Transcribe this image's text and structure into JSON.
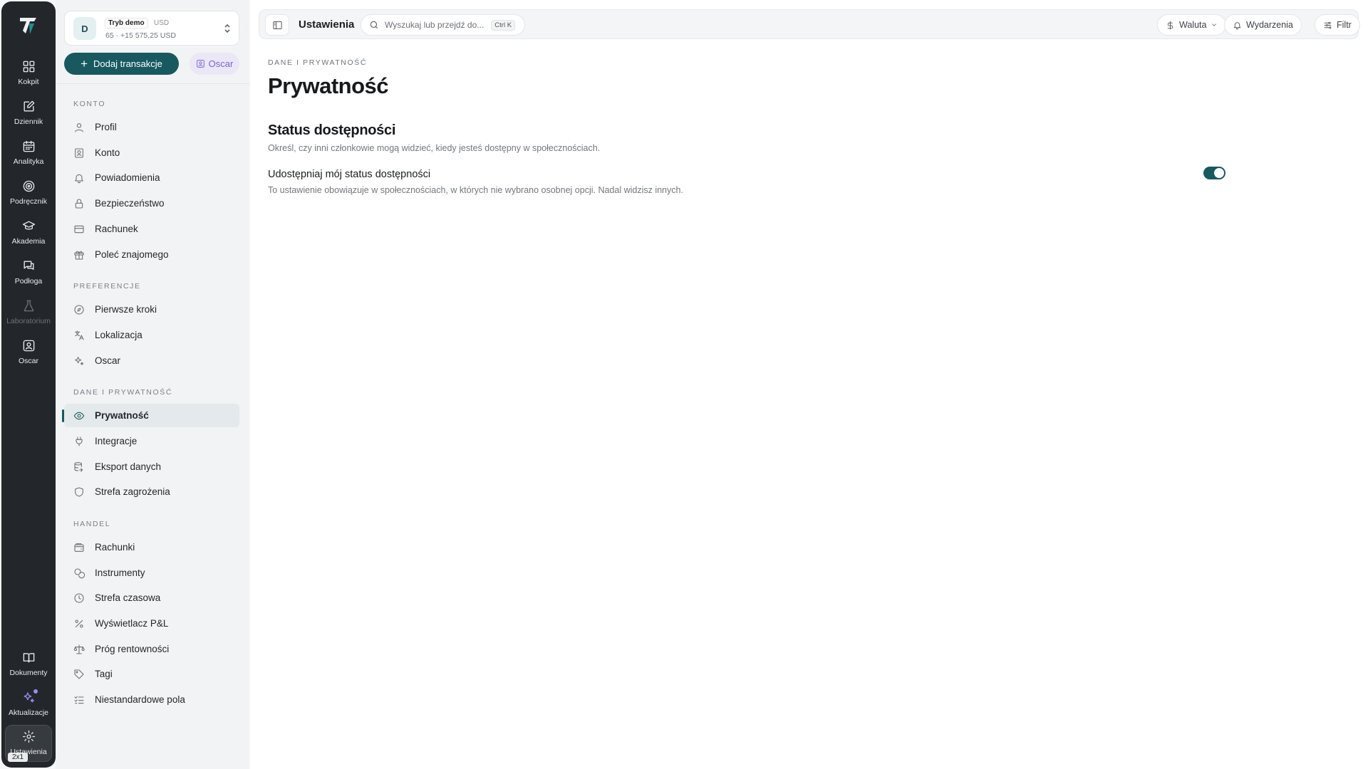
{
  "rail": {
    "items": [
      {
        "label": "Kokpit",
        "icon": "dashboard-icon"
      },
      {
        "label": "Dziennik",
        "icon": "journal-icon"
      },
      {
        "label": "Analityka",
        "icon": "calendar-icon"
      },
      {
        "label": "Podręcznik",
        "icon": "target-icon"
      },
      {
        "label": "Akademia",
        "icon": "graduation-cap-icon"
      },
      {
        "label": "Podłoga",
        "icon": "chat-icon"
      },
      {
        "label": "Laboratorium",
        "icon": "flask-icon"
      },
      {
        "label": "Oscar",
        "icon": "user-square-icon"
      }
    ],
    "bottom": [
      {
        "label": "Dokumenty",
        "icon": "book-icon"
      },
      {
        "label": "Aktualizacje",
        "icon": "sparkles-icon"
      },
      {
        "label": "Ustawienia",
        "icon": "gear-icon"
      }
    ],
    "badge": "2x1"
  },
  "account": {
    "avatar": "D",
    "mode": "Tryb demo",
    "currency": "USD",
    "balance": "65 · +15 575,25 USD"
  },
  "actions": {
    "add_label": "Dodaj transakcje",
    "oscar_label": "Oscar"
  },
  "sidebar": {
    "sections": [
      {
        "title": "KONTO",
        "items": [
          "Profil",
          "Konto",
          "Powiadomienia",
          "Bezpieczeństwo",
          "Rachunek",
          "Poleć znajomego"
        ]
      },
      {
        "title": "PREFERENCJE",
        "items": [
          "Pierwsze kroki",
          "Lokalizacja",
          "Oscar"
        ]
      },
      {
        "title": "DANE I PRYWATNOŚĆ",
        "items": [
          "Prywatność",
          "Integracje",
          "Eksport danych",
          "Strefa zagrożenia"
        ]
      },
      {
        "title": "HANDEL",
        "items": [
          "Rachunki",
          "Instrumenty",
          "Strefa czasowa",
          "Wyświetlacz P&L",
          "Próg rentowności",
          "Tagi",
          "Niestandardowe pola"
        ]
      }
    ]
  },
  "topbar": {
    "title": "Ustawienia",
    "search_placeholder": "Wyszukaj lub przejdź do...",
    "shortcut": "Ctrl K",
    "currency_label": "Waluta",
    "events_label": "Wydarzenia",
    "filter_label": "Filtr"
  },
  "page": {
    "breadcrumb": "DANE I PRYWATNOŚĆ",
    "title": "Prywatność",
    "section_title": "Status dostępności",
    "section_desc": "Określ, czy inni członkowie mogą widzieć, kiedy jesteś dostępny w społecznościach.",
    "setting_label": "Udostępniaj mój status dostępności",
    "setting_desc": "To ustawienie obowiązuje w społecznościach, w których nie wybrano osobnej opcji. Nadal widzisz innych.",
    "setting_enabled": true
  },
  "colors": {
    "accent": "#17595f",
    "rail_bg": "#23272b",
    "oscar": "#7b62d1"
  }
}
